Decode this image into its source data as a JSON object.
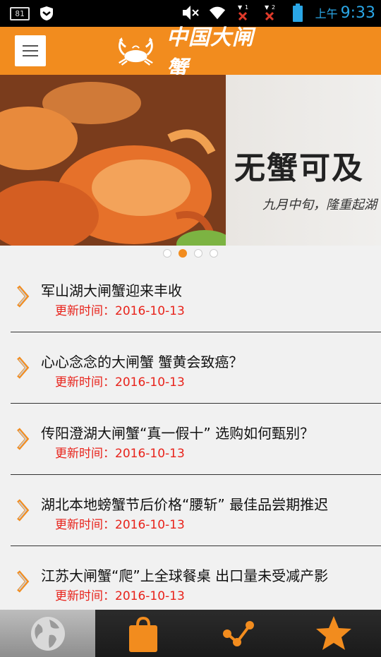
{
  "status_bar": {
    "battery_level": "81",
    "ampm": "上午",
    "time": "9:33",
    "sim1_label": "1",
    "sim2_label": "2"
  },
  "header": {
    "logo_text": "中国大闸蟹",
    "menu_icon": "hamburger-menu-icon"
  },
  "banner": {
    "headline": "无蟹可及",
    "subline": "九月中旬，隆重起湖",
    "slides": 4,
    "active_slide": 2
  },
  "news": [
    {
      "title": "军山湖大闸蟹迎来丰收",
      "date": "更新时间：2016-10-13"
    },
    {
      "title": "心心念念的大闸蟹 蟹黄会致癌？",
      "date": "更新时间：2016-10-13"
    },
    {
      "title": "传阳澄湖大闸蟹“真一假十” 选购如何甄别？",
      "date": "更新时间：2016-10-13"
    },
    {
      "title": "湖北本地螃蟹节后价格“腰斩” 最佳品尝期推迟",
      "date": "更新时间：2016-10-13"
    },
    {
      "title": "江苏大闸蟹“爬”上全球餐桌 出口量未受减产影",
      "date": "更新时间：2016-10-13"
    }
  ],
  "tabs": [
    {
      "icon": "globe-icon",
      "active": true
    },
    {
      "icon": "shopping-bag-icon",
      "active": false
    },
    {
      "icon": "share-icon",
      "active": false
    },
    {
      "icon": "star-icon",
      "active": false
    }
  ],
  "colors": {
    "accent": "#f28c1e",
    "date_red": "#e8231b",
    "status_blue": "#2aa6e6"
  }
}
